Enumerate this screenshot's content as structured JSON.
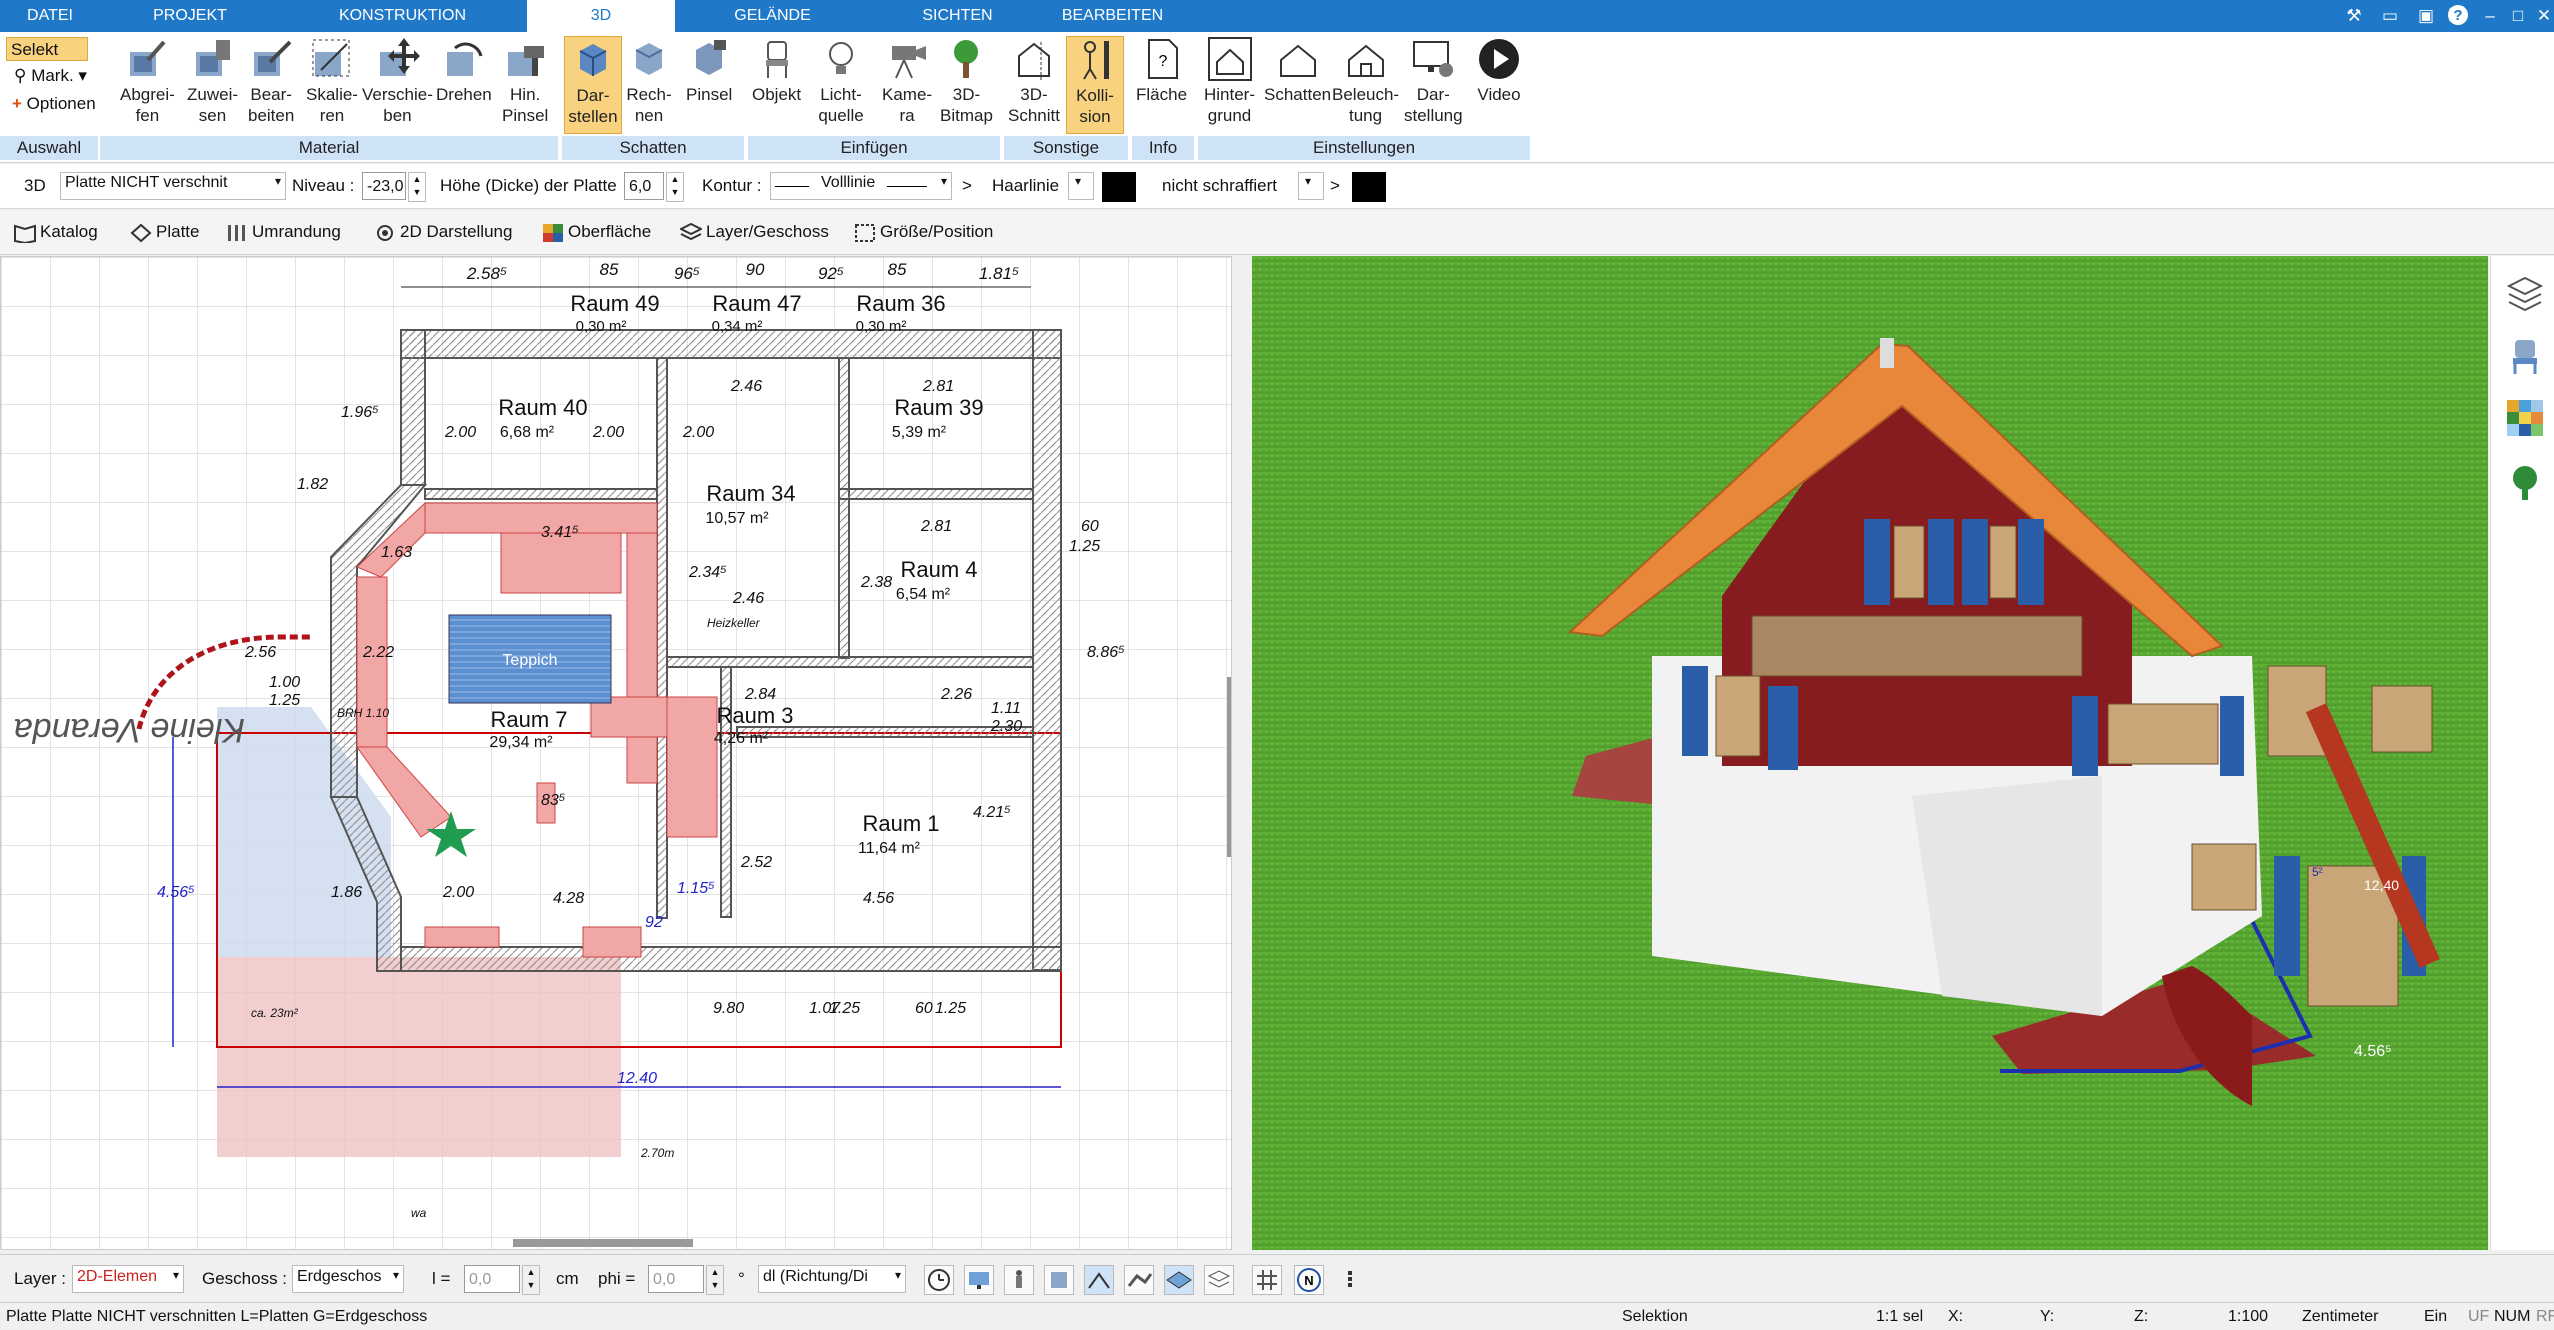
{
  "menu": {
    "tabs": [
      "DATEI",
      "PROJEKT",
      "KONSTRUKTION",
      "3D",
      "GELÄNDE",
      "SICHTEN",
      "BEARBEITEN"
    ],
    "active": "3D"
  },
  "ribbon": {
    "auswahl": {
      "select": "Selekt",
      "mark": "Mark.",
      "options": "Optionen",
      "group": "Auswahl"
    },
    "material": {
      "buttons": [
        "Abgrei-\nfen",
        "Zuwei-\nsen",
        "Bear-\nbeiten",
        "Skalie-\nren",
        "Verschie-\nben",
        "Drehen",
        "Hin.\nPinsel"
      ],
      "group": "Material"
    },
    "schatten": {
      "buttons": [
        "Dar-\nstellen",
        "Rech-\nnen",
        "Pinsel"
      ],
      "group": "Schatten"
    },
    "einfuegen": {
      "buttons": [
        "Objekt",
        "Licht-\nquelle",
        "Kame-\nra",
        "3D-\nBitmap"
      ],
      "group": "Einfügen"
    },
    "sonstige": {
      "buttons": [
        "3D-\nSchnitt",
        "Kolli-\nsion"
      ],
      "group": "Sonstige"
    },
    "info": {
      "buttons": [
        "Fläche"
      ],
      "group": "Info"
    },
    "einstellungen": {
      "buttons": [
        "Hinter-\ngrund",
        "Schatten",
        "Beleuch-\ntung",
        "Dar-\nstellung",
        "Video"
      ],
      "group": "Einstellungen"
    }
  },
  "propbar": {
    "mode": "3D",
    "plate_select": "Platte NICHT verschnit",
    "niveau_label": "Niveau :",
    "niveau_value": "-23,0",
    "hoehe_label": "Höhe (Dicke) der Platte",
    "hoehe_value": "6,0",
    "kontur_label": "Kontur :",
    "kontur_value": "Volllinie",
    "haarlinie_label": "Haarlinie",
    "schraffur_value": "nicht schraffiert"
  },
  "tabs2": [
    "Katalog",
    "Platte",
    "Umrandung",
    "2D Darstellung",
    "Oberfläche",
    "Layer/Geschoss",
    "Größe/Position"
  ],
  "plan": {
    "rooms": [
      {
        "name": "Raum 49",
        "area": "0,30 m²"
      },
      {
        "name": "Raum 47",
        "area": "0,34 m²"
      },
      {
        "name": "Raum 36",
        "area": "0,30 m²"
      },
      {
        "name": "Raum 40",
        "area": "6,68 m²"
      },
      {
        "name": "Raum 39",
        "area": "5,39 m²"
      },
      {
        "name": "Raum 34",
        "area": "10,57 m²"
      },
      {
        "name": "Raum 4",
        "area": "6,54 m²"
      },
      {
        "name": "Raum 7",
        "area": "29,34 m²"
      },
      {
        "name": "Raum 3",
        "area": "4,26 m²"
      },
      {
        "name": "Raum 1",
        "area": "11,64 m²"
      }
    ],
    "dims_top": [
      "2.58⁵",
      "85",
      "96⁵",
      "90",
      "92⁵",
      "85",
      "1.81⁵"
    ],
    "labels": [
      "Teppich",
      "Kleine Veranda",
      "3.41⁵",
      "2.46",
      "2.81",
      "1.96⁵",
      "1.82",
      "2.00",
      "2.00",
      "2.00",
      "1.63",
      "2.22",
      "1.00",
      "1.25",
      "2.56",
      "2.34⁵",
      "2.46",
      "2.38",
      "2.81",
      "60",
      "1.25",
      "8.86⁵",
      "2.84",
      "2.26",
      "1.11",
      "2.30",
      "4.28",
      "2.52",
      "4.56",
      "4.21⁵",
      "9.80",
      "1.07",
      "1.25",
      "60",
      "1.25",
      "12.40",
      "4.56⁵",
      "1.86",
      "2.00",
      "92",
      "83⁵",
      "1.15⁵",
      "BRH 1.10",
      "Heizkeller",
      "ca. 23m²",
      "2.70m",
      "wa"
    ]
  },
  "view3d": {
    "dim_front": "4.56⁵",
    "dim_side": "12,40",
    "dim_small": "5²"
  },
  "layerbar": {
    "layer_label": "Layer :",
    "layer_value": "2D-Elemen",
    "geschoss_label": "Geschoss :",
    "geschoss_value": "Erdgeschos",
    "l_label": "l =",
    "l_value": "0,0",
    "unit": "cm",
    "phi_label": "phi =",
    "phi_value": "0,0",
    "deg": "°",
    "dl_value": "dl (Richtung/Di"
  },
  "status": {
    "message": "Platte Platte NICHT verschnitten L=Platten G=Erdgeschoss",
    "mode": "Selektion",
    "sel": "1:1 sel",
    "x": "X:",
    "y": "Y:",
    "z": "Z:",
    "scale": "1:100",
    "unit": "Zentimeter",
    "ein": "Ein",
    "uf": "UF",
    "num": "NUM",
    "rf": "RF"
  },
  "colors": {
    "accent": "#1f78c8",
    "ribbon_group": "#cfe3f7",
    "highlight": "#f9d27f",
    "grass": "#5cab34",
    "roof": "#e8873a",
    "wall_red": "#8a1c1e",
    "shutter": "#2a5ea8"
  }
}
